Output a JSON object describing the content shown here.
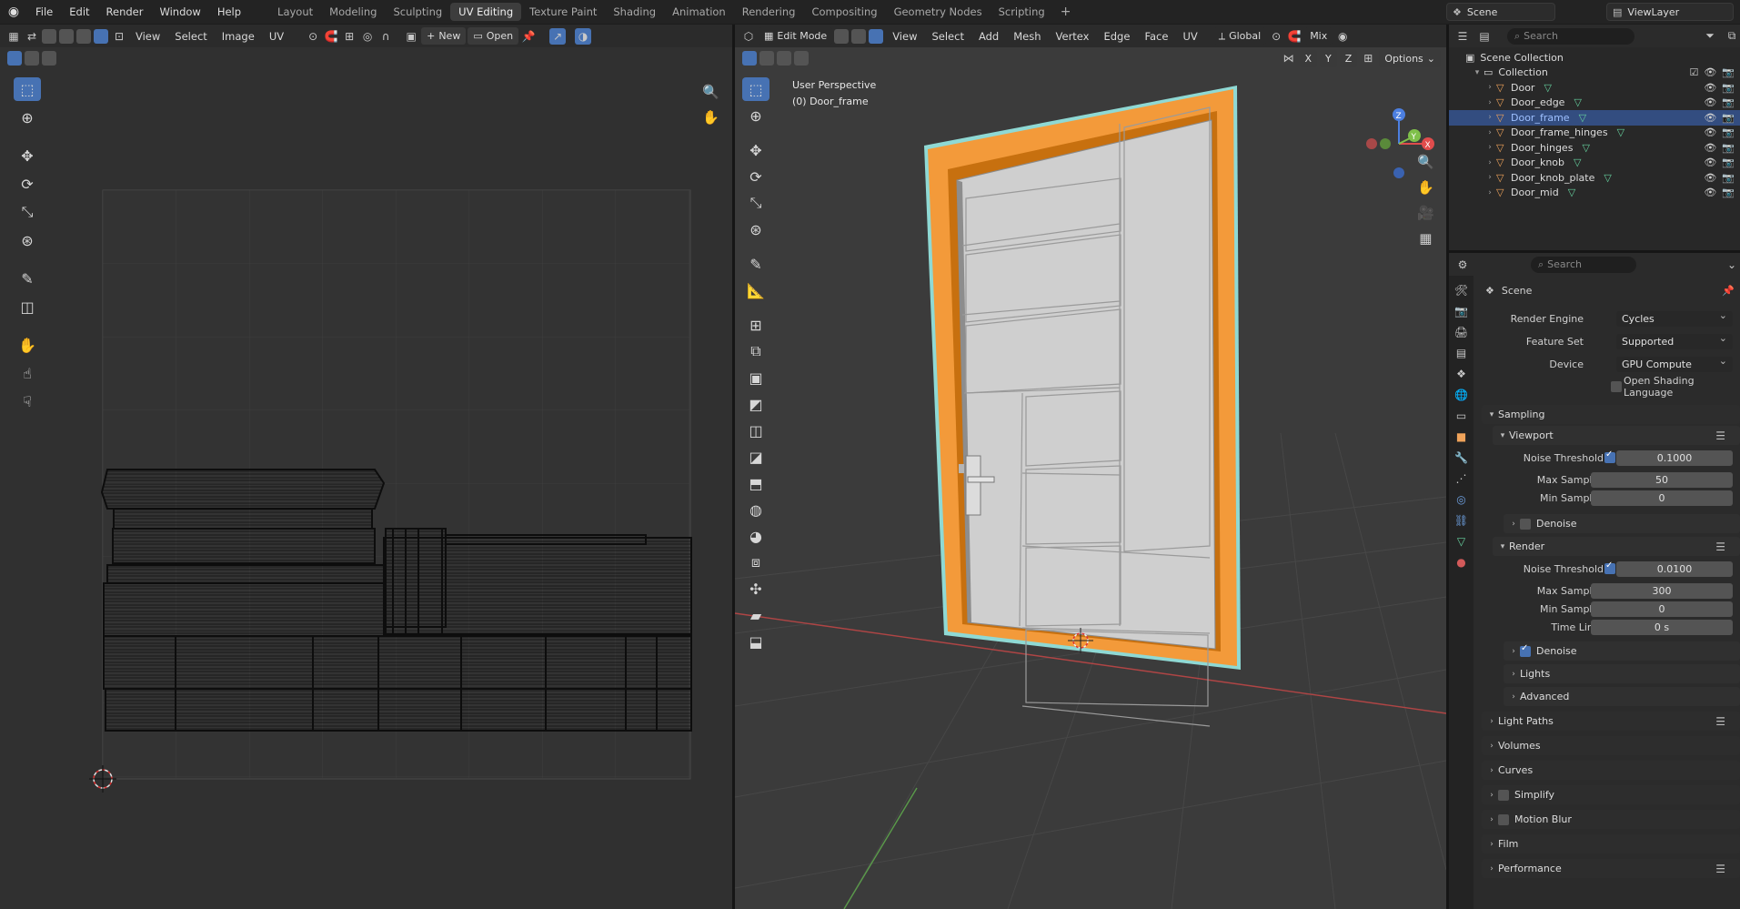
{
  "app": {
    "menus": [
      "File",
      "Edit",
      "Render",
      "Window",
      "Help"
    ],
    "workspaces": [
      "Layout",
      "Modeling",
      "Sculpting",
      "UV Editing",
      "Texture Paint",
      "Shading",
      "Animation",
      "Rendering",
      "Compositing",
      "Geometry Nodes",
      "Scripting"
    ],
    "active_workspace": "UV Editing",
    "plus": "+",
    "scene": "Scene",
    "view_layer": "ViewLayer"
  },
  "uv_editor": {
    "menus": [
      "View",
      "Select",
      "Image",
      "UV"
    ],
    "new_label": "New",
    "open_label": "Open"
  },
  "viewport": {
    "mode": "Edit Mode",
    "menus": [
      "View",
      "Select",
      "Add",
      "Mesh",
      "Vertex",
      "Edge",
      "Face",
      "UV"
    ],
    "orientation": "Global",
    "shading": "Mix",
    "options": "Options",
    "axes": [
      "X",
      "Y",
      "Z"
    ],
    "overlay_line1": "User Perspective",
    "overlay_line2": "(0) Door_frame",
    "gizmo": {
      "x": "X",
      "y": "Y",
      "z": "Z"
    }
  },
  "outliner": {
    "search_placeholder": "Search",
    "root": "Scene Collection",
    "collection": "Collection",
    "objects": [
      "Door",
      "Door_edge",
      "Door_frame",
      "Door_frame_hinges",
      "Door_hinges",
      "Door_knob",
      "Door_knob_plate",
      "Door_mid"
    ],
    "selected": "Door_frame"
  },
  "properties": {
    "search_placeholder": "Search",
    "context": "Scene",
    "render_engine_label": "Render Engine",
    "render_engine": "Cycles",
    "feature_set_label": "Feature Set",
    "feature_set": "Supported",
    "device_label": "Device",
    "device": "GPU Compute",
    "osl_label": "Open Shading Language",
    "sampling": "Sampling",
    "viewport": "Viewport",
    "vp_noise_label": "Noise Threshold",
    "vp_noise": "0.1000",
    "vp_max_label": "Max Samples",
    "vp_max": "50",
    "vp_min_label": "Min Samples",
    "vp_min": "0",
    "denoise": "Denoise",
    "render": "Render",
    "r_noise_label": "Noise Threshold",
    "r_noise": "0.0100",
    "r_max_label": "Max Samples",
    "r_max": "300",
    "r_min_label": "Min Samples",
    "r_min": "0",
    "time_limit_label": "Time Limit",
    "time_limit": "0 s",
    "lights": "Lights",
    "advanced": "Advanced",
    "panels": [
      "Light Paths",
      "Volumes",
      "Curves",
      "Simplify",
      "Motion Blur",
      "Film",
      "Performance"
    ]
  }
}
